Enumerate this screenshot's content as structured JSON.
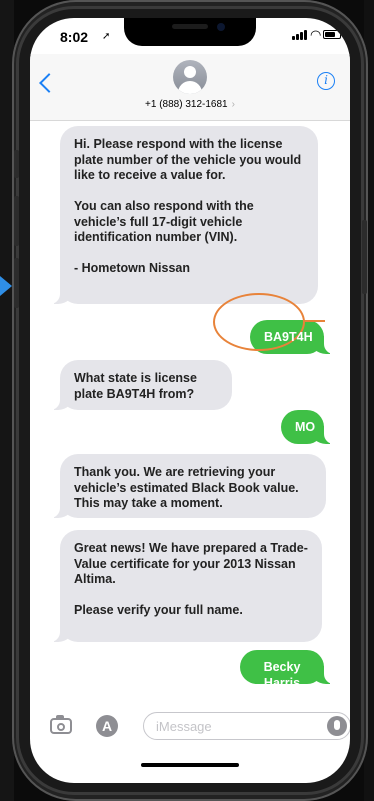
{
  "status_bar": {
    "time": "8:02",
    "location_icon": "location-arrow-icon",
    "signal_icon": "signal-bars-icon",
    "wifi_icon": "wifi-icon",
    "battery_icon": "battery-icon"
  },
  "header": {
    "back_icon": "chevron-left-icon",
    "avatar_icon": "person-avatar-icon",
    "contact": "+1 (888) 312-1681",
    "contact_chevron": "›",
    "info_icon": "info-icon",
    "info_glyph": "i"
  },
  "messages": [
    {
      "direction": "incoming",
      "text": "Hi. Please respond with the license plate number of the vehicle you would like to receive a value for.\n\nYou can also respond with the vehicle’s full 17-digit vehicle identification number (VIN).\n\n- Hometown Nissan"
    },
    {
      "direction": "outgoing",
      "text": "BA9T4H"
    },
    {
      "direction": "incoming",
      "text": "What state is license plate BA9T4H from?"
    },
    {
      "direction": "outgoing",
      "text": "MO"
    },
    {
      "direction": "incoming",
      "text": "Thank you. We are retrieving your vehicle’s estimated Black Book value. This may take a moment."
    },
    {
      "direction": "incoming",
      "text": "Great news! We have prepared a Trade-Value certificate for your 2013 Nissan Altima.\n\nPlease verify your full name."
    },
    {
      "direction": "outgoing",
      "text": "Becky Harris"
    }
  ],
  "input_bar": {
    "camera_icon": "camera-icon",
    "appstore_icon": "app-store-icon",
    "appstore_glyph": "A",
    "placeholder": "iMessage",
    "mic_icon": "microphone-icon"
  },
  "colors": {
    "outgoing_bubble": "#3fc046",
    "incoming_bubble": "#e5e5ea",
    "ios_blue": "#1b80f5",
    "highlight": "#e8833a",
    "callout_arrow": "#2f8ee6"
  }
}
